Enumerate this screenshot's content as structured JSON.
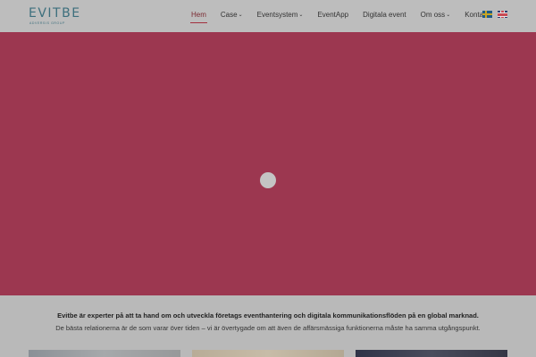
{
  "header": {
    "logo": {
      "name": "EVITBE",
      "tagline": "ADVERSIS GROUP"
    },
    "nav": [
      {
        "label": "Hem",
        "active": true,
        "dropdown": false
      },
      {
        "label": "Case",
        "active": false,
        "dropdown": true
      },
      {
        "label": "Eventsystem",
        "active": false,
        "dropdown": true
      },
      {
        "label": "EventApp",
        "active": false,
        "dropdown": false
      },
      {
        "label": "Digitala event",
        "active": false,
        "dropdown": false
      },
      {
        "label": "Om oss",
        "active": false,
        "dropdown": true
      },
      {
        "label": "Kontakt",
        "active": false,
        "dropdown": false
      }
    ],
    "chevron_glyph": "⌄",
    "flags": [
      "swedish-flag-icon",
      "british-flag-icon"
    ]
  },
  "hero": {
    "background": "#9c3750",
    "loader_icon": "loading-spinner-icon"
  },
  "intro": {
    "headline": "Evitbe är experter på att ta hand om och utveckla företags eventhantering och digitala kommunikationsflöden på en global marknad.",
    "body": "De bästa relationerna är de som varar över tiden – vi är övertygade om att även de affärsmässiga funktionerna måste ha samma utgångspunkt."
  },
  "colors": {
    "brand": "#3d6f7d",
    "accent": "#a3303e",
    "overlay": "#bdbdbd"
  }
}
